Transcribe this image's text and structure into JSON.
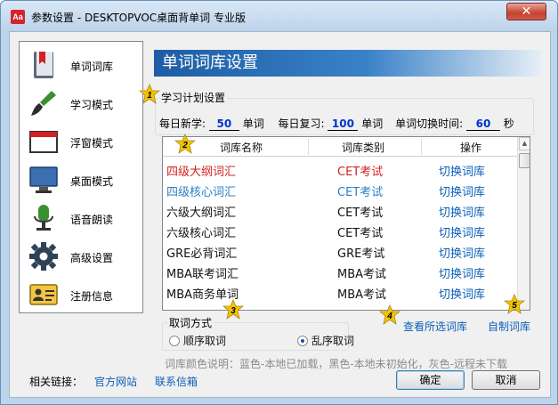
{
  "window": {
    "app_icon": "Aa",
    "title": "参数设置 - DESKTOPVOC桌面背单词 专业版",
    "close_glyph": "✕"
  },
  "sidebar": {
    "items": [
      {
        "label": "单词词库",
        "icon": "bookmark-book-icon"
      },
      {
        "label": "学习模式",
        "icon": "paintbrush-icon"
      },
      {
        "label": "浮窗模式",
        "icon": "floating-window-icon"
      },
      {
        "label": "桌面模式",
        "icon": "monitor-icon"
      },
      {
        "label": "语音朗读",
        "icon": "microphone-icon"
      },
      {
        "label": "高级设置",
        "icon": "gear-icon"
      },
      {
        "label": "注册信息",
        "icon": "id-card-icon"
      }
    ]
  },
  "panel": {
    "title": "单词词库设置",
    "plan": {
      "group_title": "学习计划设置",
      "daily_new_label": "每日新学:",
      "daily_new_value": "50",
      "daily_new_unit": "单词",
      "daily_review_label": "每日复习:",
      "daily_review_value": "100",
      "daily_review_unit": "单词",
      "switch_label": "单词切换时间:",
      "switch_value": "60",
      "switch_unit": "秒"
    },
    "table": {
      "headers": [
        "词库名称",
        "词库类别",
        "操作"
      ],
      "rows": [
        {
          "name": "四级大纲词汇",
          "category": "CET考试",
          "action": "切换词库",
          "color": "#d42121"
        },
        {
          "name": "四级核心词汇",
          "category": "CET考试",
          "action": "切换词库",
          "color": "#2a7fc4"
        },
        {
          "name": "六级大纲词汇",
          "category": "CET考试",
          "action": "切换词库",
          "color": "#111111"
        },
        {
          "name": "六级核心词汇",
          "category": "CET考试",
          "action": "切换词库",
          "color": "#111111"
        },
        {
          "name": "GRE必背词汇",
          "category": "GRE考试",
          "action": "切换词库",
          "color": "#111111"
        },
        {
          "name": "MBA联考词汇",
          "category": "MBA考试",
          "action": "切换词库",
          "color": "#111111"
        },
        {
          "name": "MBA商务单词",
          "category": "MBA考试",
          "action": "切换词库",
          "color": "#111111"
        }
      ]
    },
    "fetch": {
      "group_title": "取词方式",
      "options": [
        "顺序取词",
        "乱序取词"
      ],
      "selected": "乱序取词"
    },
    "view_selected_link": "查看所选词库",
    "custom_link": "自制词库",
    "color_note": "词库颜色说明：蓝色-本地已加载，黑色-本地未初始化，灰色-远程未下载",
    "callouts": [
      "1",
      "2",
      "3",
      "4",
      "5"
    ]
  },
  "footer": {
    "links_label": "相关链接：",
    "official_site": "官方网站",
    "contact_email": "联系信箱",
    "ok": "确定",
    "cancel": "取消"
  },
  "colors": {
    "cet_category_red": "#d42121",
    "loaded_blue": "#2a7fc4",
    "link_blue": "#0b5fb8",
    "callout_yellow": "#f5c400"
  }
}
